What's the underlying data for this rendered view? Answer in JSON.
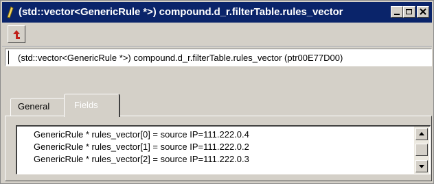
{
  "window": {
    "title": "(std::vector<GenericRule *>) compound.d_r.filterTable.rules_vector",
    "title_icon": "tool-icon",
    "controls": {
      "minimize_icon": "minimize-icon",
      "maximize_icon": "maximize-icon",
      "close_icon": "close-icon"
    }
  },
  "toolbar": {
    "up_button_icon": "up-arrow-icon",
    "accent_color": "#b22222"
  },
  "path_field": {
    "value": "(std::vector<GenericRule *>) compound.d_r.filterTable.rules_vector  (ptr00E77D00)"
  },
  "tabs": [
    {
      "label": "General",
      "active": false
    },
    {
      "label": "Fields",
      "active": true
    }
  ],
  "fields_list": {
    "items": [
      "GenericRule * rules_vector[0]  =  source IP=111.222.0.4",
      "GenericRule * rules_vector[1]  =  source IP=111.222.0.2",
      "GenericRule * rules_vector[2]  =  source IP=111.222.0.3"
    ]
  },
  "colors": {
    "titlebar": "#0a246a",
    "face": "#d4d0c8"
  }
}
